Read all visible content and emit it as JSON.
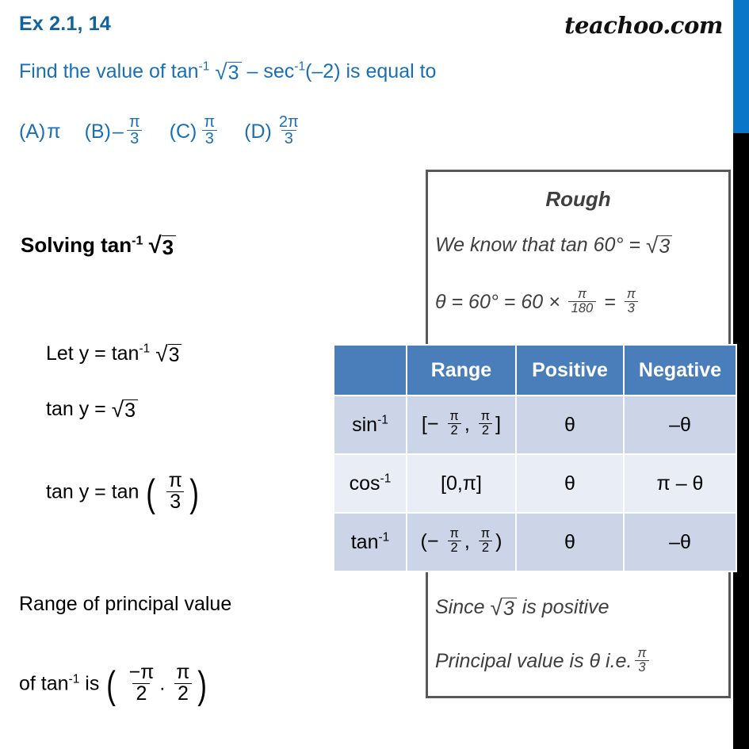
{
  "header": {
    "title": "Ex 2.1, 14",
    "brand": "teachoo.com",
    "question_prefix": "Find the value of tan",
    "question_exp": "-1",
    "question_mid": " – sec",
    "question_exp2": "-1",
    "question_tail": "(–2) is equal to",
    "radicand": "3",
    "title_color": "#11639e",
    "question_color": "#1b6fb3"
  },
  "options": [
    {
      "label": "(A)",
      "value": "π",
      "sign": "",
      "num": "",
      "den": ""
    },
    {
      "label": "(B)",
      "value": "",
      "sign": "–",
      "num": "π",
      "den": "3"
    },
    {
      "label": "(C)",
      "value": "",
      "sign": "",
      "num": "π",
      "den": "3"
    },
    {
      "label": "(D)",
      "value": "",
      "sign": "",
      "num": "2π",
      "den": "3"
    }
  ],
  "work": {
    "solving_prefix": "Solving tan",
    "solving_exp": "-1",
    "solving_radicand": "3",
    "let_prefix": "Let y =  tan",
    "let_exp": "-1",
    "let_radicand": "3",
    "tany_prefix": "tan y = ",
    "tany_radicand": "3",
    "tantan_prefix": "tan y = tan ",
    "tantan_num": "π",
    "tantan_den": "3",
    "range_line1": "Range of principal value",
    "range_prefix": "of tan",
    "range_exp": "-1",
    "range_mid": " is ",
    "range_num1": "−π",
    "range_den1": "2",
    "range_sep": ".",
    "range_num2": "π",
    "range_den2": "2"
  },
  "rough": {
    "title": "Rough",
    "line1_prefix": "We know that tan 60° = ",
    "line1_radicand": "3",
    "line2_prefix": "θ = 60° = 60 × ",
    "line2_num1": "π",
    "line2_den1": "180",
    "line2_eq": " = ",
    "line2_num2": "π",
    "line2_den2": "3",
    "line3_prefix": "Since ",
    "line3_radicand": "3",
    "line3_suffix": " is positive",
    "line4_prefix": "Principal value is  θ i.e.",
    "line4_num": "π",
    "line4_den": "3"
  },
  "table": {
    "headers": [
      "",
      "Range",
      "Positive",
      "Negative"
    ],
    "header_bg": "#4a7ebb",
    "row_bg_odd": "#ccd5e8",
    "row_bg_even": "#e9edf6",
    "rows": [
      {
        "func": "sin",
        "func_exp": "-1",
        "range_open": "[−",
        "range_num1": "π",
        "range_den1": "2",
        "range_comma": ",",
        "range_num2": "π",
        "range_den2": "2",
        "range_close": "]",
        "range_plain": "",
        "positive": "θ",
        "negative": "–θ"
      },
      {
        "func": "cos",
        "func_exp": "-1",
        "range_open": "",
        "range_num1": "",
        "range_den1": "",
        "range_comma": "",
        "range_num2": "",
        "range_den2": "",
        "range_close": "",
        "range_plain": "[0,π]",
        "positive": "θ",
        "negative": "π – θ"
      },
      {
        "func": "tan",
        "func_exp": "-1",
        "range_open": "(−",
        "range_num1": "π",
        "range_den1": "2",
        "range_comma": ",",
        "range_num2": "π",
        "range_den2": "2",
        "range_close": ")",
        "range_plain": "",
        "positive": "θ",
        "negative": "–θ"
      }
    ]
  },
  "decor": {
    "blue_strip_color": "#0a76c8",
    "black_strip_color": "#000000",
    "rough_border_color": "#595959"
  }
}
